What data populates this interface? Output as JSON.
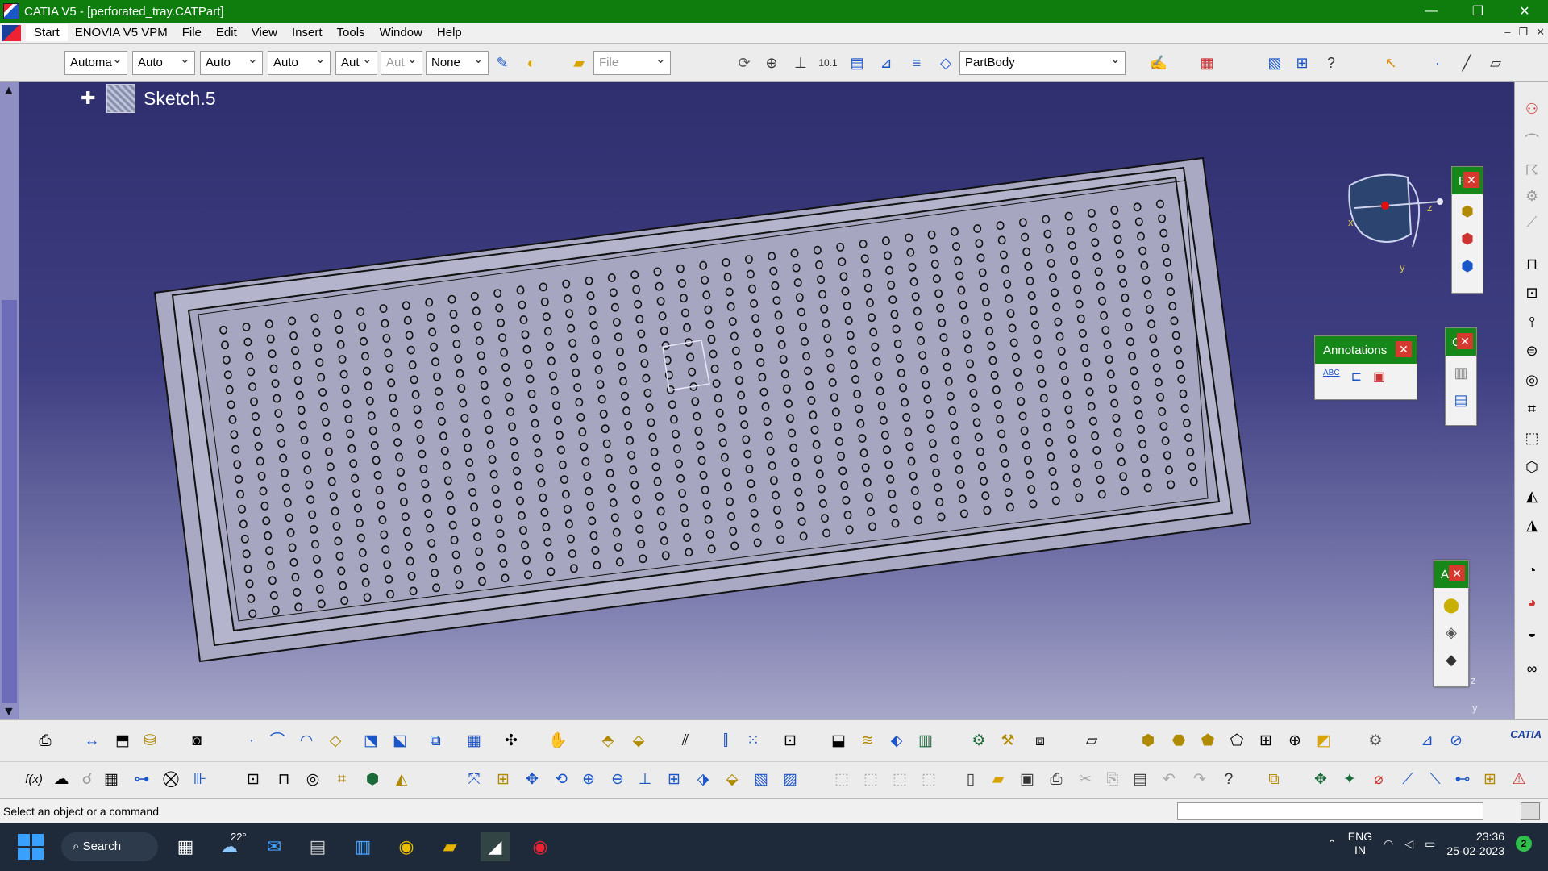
{
  "window": {
    "title": "CATIA V5 - [perforated_tray.CATPart]",
    "min": "—",
    "restore": "❐",
    "close": "✕"
  },
  "menu": {
    "items": [
      "Start",
      "ENOVIA V5 VPM",
      "File",
      "Edit",
      "View",
      "Insert",
      "Tools",
      "Window",
      "Help"
    ],
    "mdi": [
      "–",
      "❐",
      "✕"
    ]
  },
  "toolbar": {
    "combos": [
      "Automa",
      "Auto",
      "Auto",
      "Auto",
      "Aut",
      "Aut",
      "None"
    ],
    "file_combo": "File",
    "body_combo": "PartBody"
  },
  "tree": {
    "node": "Sketch.5"
  },
  "compass": {
    "x": "x",
    "y": "y",
    "z": "z"
  },
  "axis": {
    "z": "z",
    "y": "y"
  },
  "floating": {
    "annotations": "Annotations",
    "p_title": "F",
    "c_title": "C",
    "a_title": "A",
    "abc": "ABC"
  },
  "status": {
    "message": "Select an object or a command"
  },
  "brand": {
    "logo": "CATIA"
  },
  "taskbar": {
    "search": "Search",
    "temp": "22°",
    "lang1": "ENG",
    "lang2": "IN",
    "time": "23:36",
    "date": "25-02-2023",
    "notifications": "2"
  },
  "colors": {
    "titlebar": "#0e7d0e",
    "viewport_top": "#2f2f6f",
    "part": "#aaaac6"
  }
}
